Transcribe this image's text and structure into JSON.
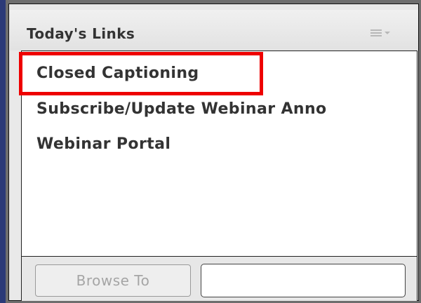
{
  "panel": {
    "title": "Today's Links",
    "menu_icon": "menu-dropdown-icon"
  },
  "links": [
    {
      "label": "Closed Captioning",
      "highlighted": true
    },
    {
      "label": "Subscribe/Update Webinar Anno"
    },
    {
      "label": "Webinar Portal"
    }
  ],
  "footer": {
    "browse_label": "Browse To",
    "url_value": ""
  },
  "colors": {
    "highlight": "#ee0000",
    "frame": "#2b3a78",
    "panel_bg": "#e9e9e9",
    "text": "#333333"
  }
}
